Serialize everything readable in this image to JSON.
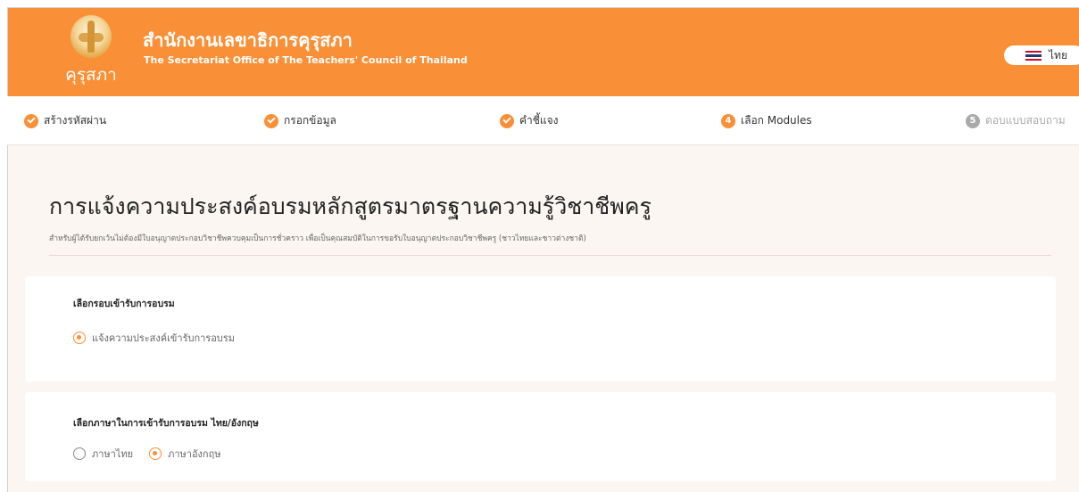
{
  "header": {
    "logo_text": "คุรุสภา",
    "org_name_th": "สำนักงานเลขาธิการคุรุสภา",
    "org_name_en": "The Secretariat Office of The Teachers' Council of Thailand",
    "language_label": "ไทย",
    "flag_icon": "thai-flag-icon",
    "brand_color": "#f98f36"
  },
  "stepper": {
    "steps": [
      {
        "label": "สร้างรหัสผ่าน",
        "status": "done"
      },
      {
        "label": "กรอกข้อมูล",
        "status": "done"
      },
      {
        "label": "คำชี้แจง",
        "status": "done"
      },
      {
        "label": "เลือก Modules",
        "status": "current",
        "number": "4"
      },
      {
        "label": "ตอบแบบสอบถาม",
        "status": "pending",
        "number": "5"
      }
    ]
  },
  "page": {
    "title": "การแจ้งความประสงค์อบรมหลักสูตรมาตรฐานความรู้วิชาชีพครู",
    "subtitle": "สำหรับผู้ได้รับยกเว้นไม่ต้องมีใบอนุญาตประกอบวิชาชีพควบคุมเป็นการชั่วคราว เพื่อเป็นคุณสมบัติในการขอรับใบอนุญาตประกอบวิชาชีพครู (ชาวไทยและชาวต่างชาติ)"
  },
  "training_round": {
    "title": "เลือกรอบเข้ารับการอบรม",
    "option_label": "แจ้งความประสงค์เข้ารับการอบรม",
    "selected": true
  },
  "language_choice": {
    "title": "เลือกภาษาในการเข้ารับการอบรม ไทย/อังกฤษ",
    "options": [
      "ภาษาไทย",
      "ภาษาอังกฤษ"
    ],
    "selected": "ภาษาอังกฤษ"
  }
}
